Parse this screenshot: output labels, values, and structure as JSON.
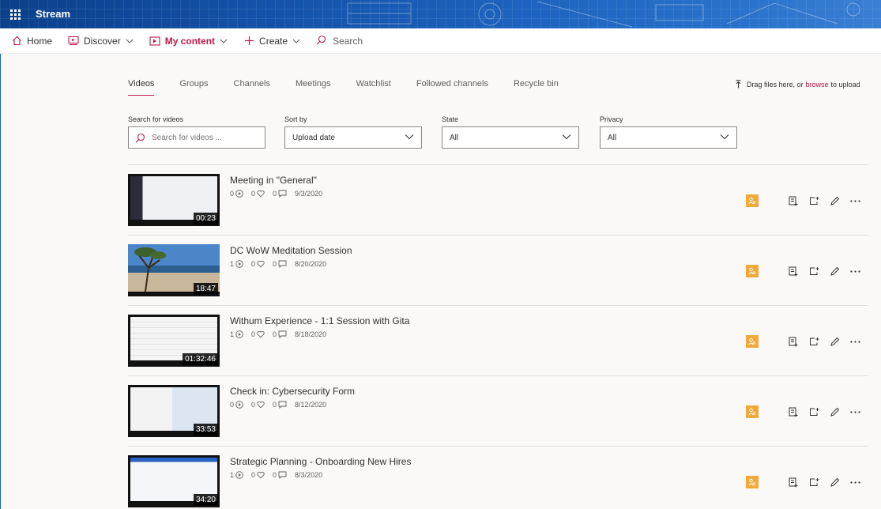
{
  "app": {
    "name": "Stream"
  },
  "nav": {
    "home": "Home",
    "discover": "Discover",
    "my_content": "My content",
    "create": "Create",
    "search": "Search"
  },
  "tabs": [
    {
      "label": "Videos",
      "active": true
    },
    {
      "label": "Groups"
    },
    {
      "label": "Channels"
    },
    {
      "label": "Meetings"
    },
    {
      "label": "Watchlist"
    },
    {
      "label": "Followed channels"
    },
    {
      "label": "Recycle bin"
    }
  ],
  "upload": {
    "prefix": "Drag files here, or",
    "link": "browse",
    "suffix": "to upload"
  },
  "filters": {
    "search": {
      "label": "Search for videos",
      "placeholder": "Search for videos ..."
    },
    "sort": {
      "label": "Sort by",
      "value": "Upload date"
    },
    "state": {
      "label": "State",
      "value": "All"
    },
    "privacy": {
      "label": "Privacy",
      "value": "All"
    }
  },
  "videos": [
    {
      "title": "Meeting in \"General\"",
      "views": "0",
      "likes": "0",
      "comments": "0",
      "date": "9/3/2020",
      "duration": "00:23"
    },
    {
      "title": "DC WoW Meditation Session",
      "views": "1",
      "likes": "0",
      "comments": "0",
      "date": "8/20/2020",
      "duration": "18:47"
    },
    {
      "title": "Withum Experience - 1:1 Session with Gita",
      "views": "1",
      "likes": "0",
      "comments": "0",
      "date": "8/18/2020",
      "duration": "01:32:46"
    },
    {
      "title": "Check in: Cybersecurity Form",
      "views": "0",
      "likes": "0",
      "comments": "0",
      "date": "8/12/2020",
      "duration": "33:53"
    },
    {
      "title": "Strategic Planning - Onboarding New Hires",
      "views": "1",
      "likes": "0",
      "comments": "0",
      "date": "8/3/2020",
      "duration": "34:20"
    }
  ],
  "colors": {
    "accent": "#bc1948",
    "banner": "#1452a8",
    "badge": "#f2a93b"
  },
  "icons": {
    "nav": [
      "waffle-icon",
      "home-icon",
      "discover-icon",
      "my-content-icon",
      "plus-icon",
      "search-icon"
    ],
    "row_actions": [
      "playlist-add-icon",
      "watchlist-add-icon",
      "edit-icon",
      "more-icon"
    ],
    "badge": "people-icon"
  }
}
